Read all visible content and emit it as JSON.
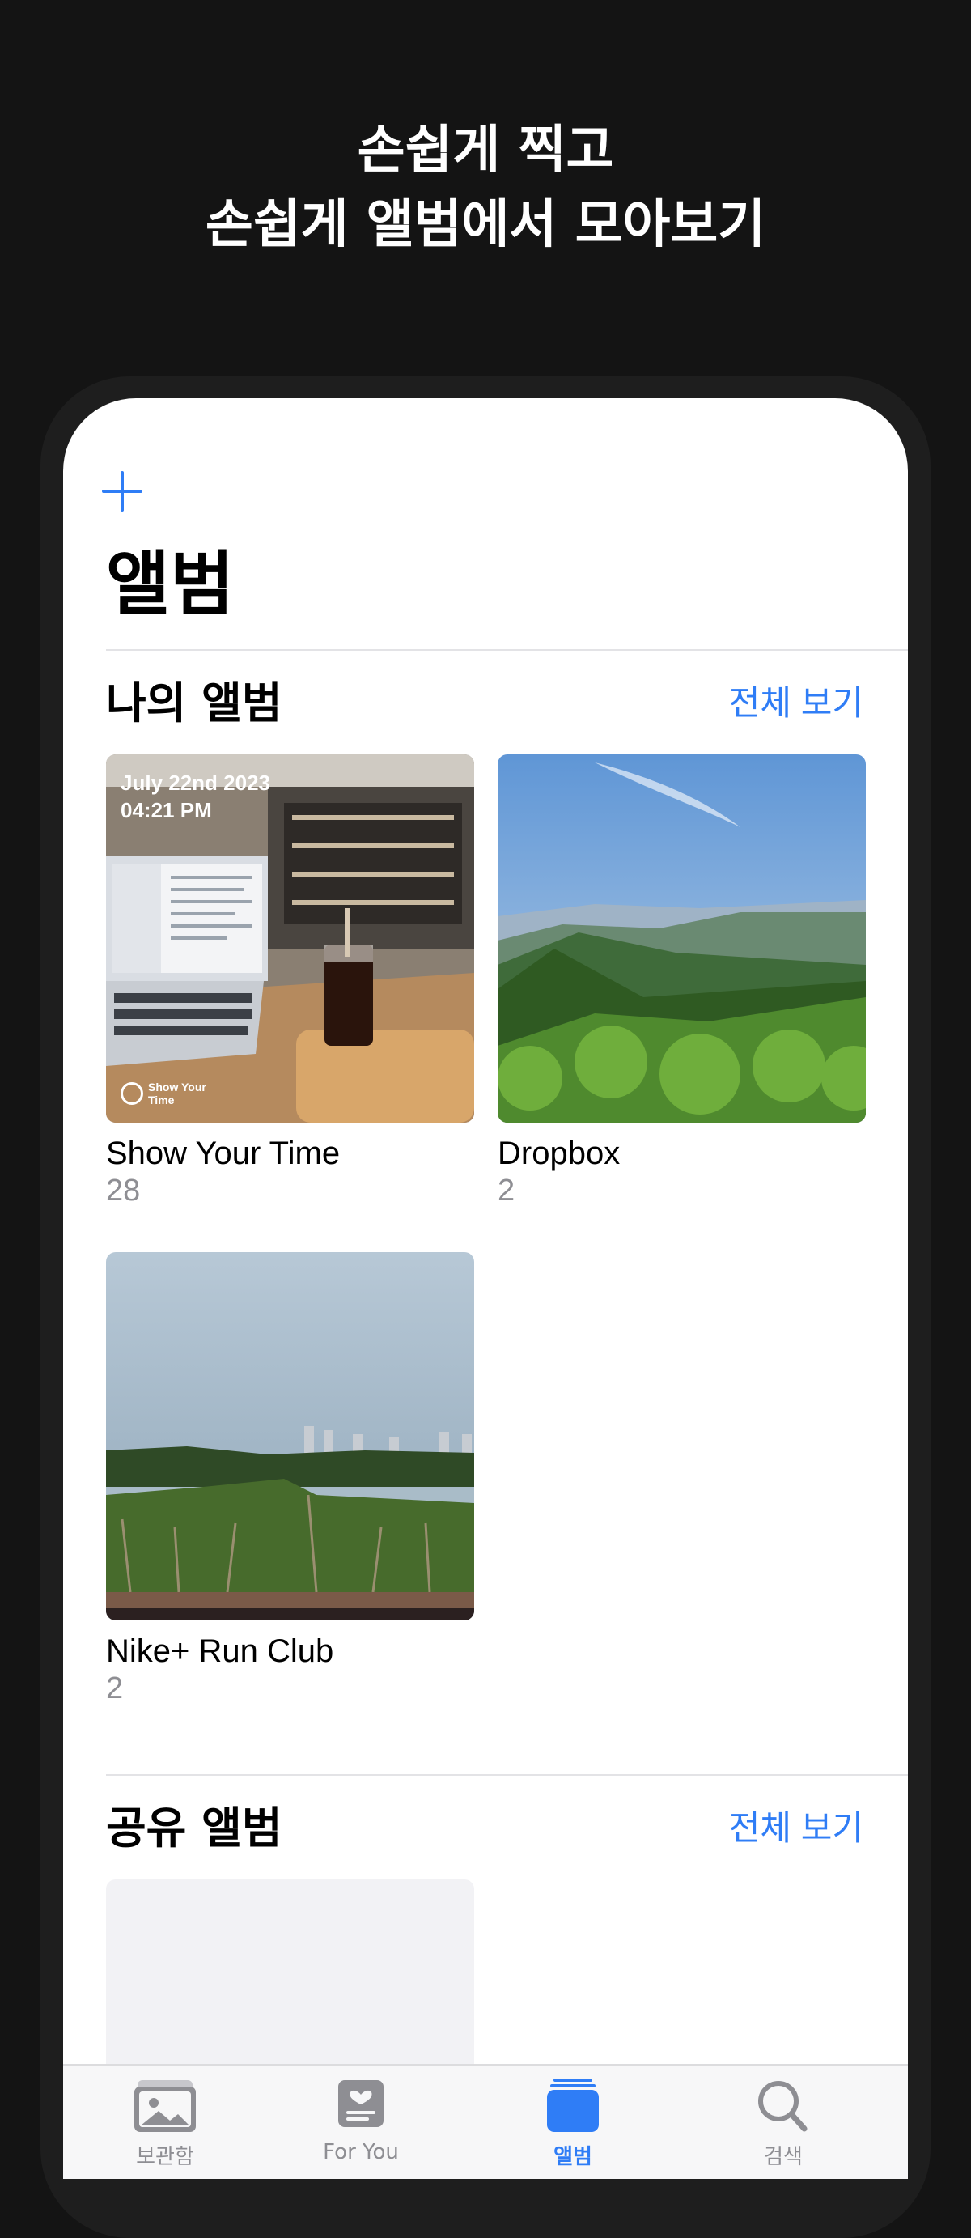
{
  "headline": {
    "line1": "손쉽게 찍고",
    "line2": "손쉽게 앨범에서 모아보기"
  },
  "screen": {
    "title": "앨범",
    "my_albums": {
      "title": "나의 앨범",
      "see_all": "전체 보기",
      "albums": [
        {
          "name": "Show Your Time",
          "count": "28",
          "overlay_date": "July 22nd 2023",
          "overlay_time": "04:21 PM",
          "overlay_badge": "Show Your Time"
        },
        {
          "name": "Dropbox",
          "count": "2"
        },
        {
          "name": "Nike+ Run Club",
          "count": "2"
        }
      ]
    },
    "shared_albums": {
      "title": "공유 앨범",
      "see_all": "전체 보기"
    }
  },
  "tabbar": {
    "tabs": [
      {
        "label": "보관함",
        "icon": "photo-library-icon",
        "active": false
      },
      {
        "label": "For You",
        "icon": "for-you-icon",
        "active": false
      },
      {
        "label": "앨범",
        "icon": "album-stack-icon",
        "active": true
      },
      {
        "label": "검색",
        "icon": "search-icon",
        "active": false
      }
    ]
  },
  "colors": {
    "accent": "#2f7df6",
    "background": "#141414",
    "secondary_text": "#8e8e93"
  }
}
